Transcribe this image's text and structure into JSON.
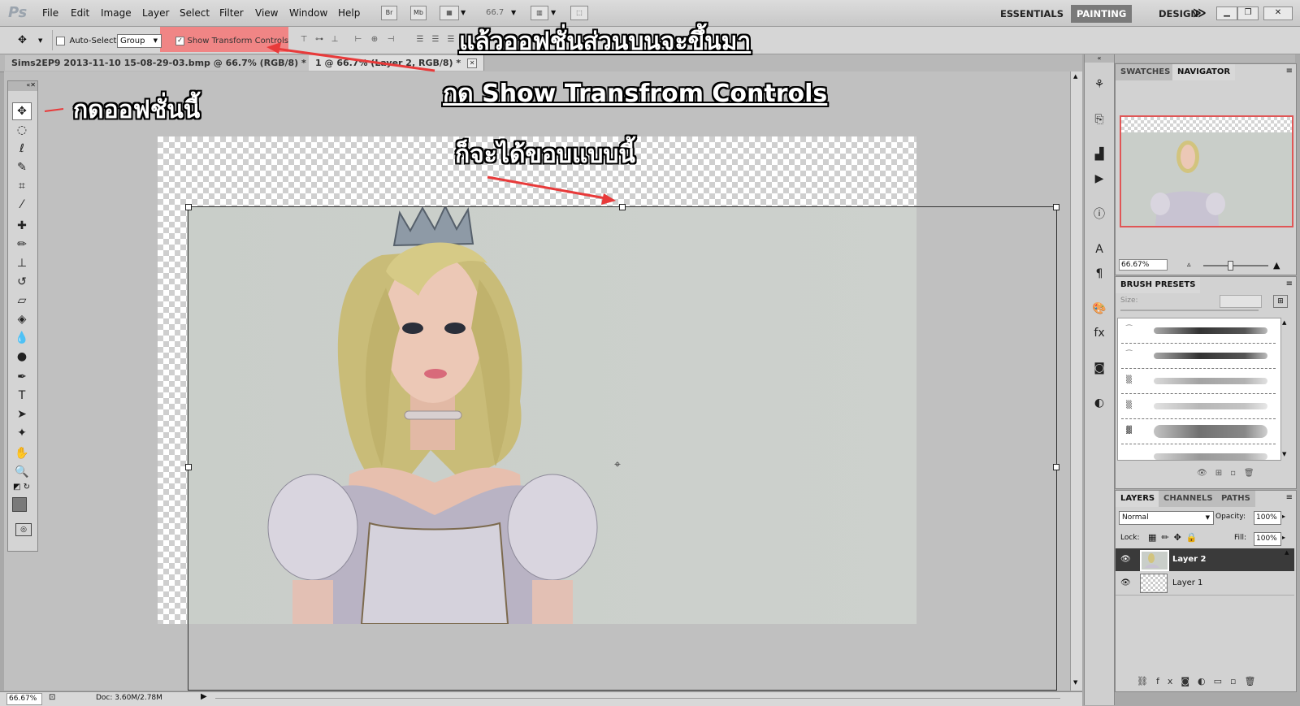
{
  "app": {
    "logo": "Ps",
    "menu": [
      "File",
      "Edit",
      "Image",
      "Layer",
      "Select",
      "Filter",
      "View",
      "Window",
      "Help"
    ],
    "bridge_buttons": [
      "Br",
      "Mb"
    ],
    "zoom_combo": "66.7",
    "workspaces": [
      "ESSENTIALS",
      "PAINTING",
      "DESIGN"
    ],
    "active_workspace": "PAINTING",
    "more_glyph": "≫"
  },
  "options_bar": {
    "auto_select_label": "Auto-Select:",
    "auto_select_checked": false,
    "auto_select_value": "Group",
    "show_transform_label": "Show Transform Controls",
    "show_transform_checked": true
  },
  "tabs": [
    {
      "label": "Sims2EP9 2013-11-10 15-08-29-03.bmp @ 66.7% (RGB/8) *",
      "active": false
    },
    {
      "label": "1 @ 66.7% (Layer 2, RGB/8) *",
      "active": true
    }
  ],
  "annotations": {
    "top": "แล้วออฟชั่นส่วนบนจะขึ้นมา",
    "show": "กด Show Transfrom Controls",
    "tool": "กดออฟชั่นนี้",
    "border": "ก็จะได้ขอบแบบนี้"
  },
  "navigator": {
    "tabs": [
      "SWATCHES",
      "NAVIGATOR"
    ],
    "active_tab": "NAVIGATOR",
    "zoom": "66.67%"
  },
  "brush_presets": {
    "title": "BRUSH PRESETS",
    "size_label": "Size:"
  },
  "layers_panel": {
    "tabs": [
      "LAYERS",
      "CHANNELS",
      "PATHS"
    ],
    "active_tab": "LAYERS",
    "blend_mode": "Normal",
    "opacity_label": "Opacity:",
    "opacity": "100%",
    "lock_label": "Lock:",
    "fill_label": "Fill:",
    "fill": "100%",
    "layers": [
      {
        "name": "Layer 2",
        "selected": true
      },
      {
        "name": "Layer 1",
        "selected": false
      }
    ]
  },
  "status": {
    "zoom": "66.67%",
    "doc": "Doc: 3.60M/2.78M"
  },
  "colors": {
    "highlight": "#f08585",
    "arrow": "#e83a3a",
    "canvas_bg": "#c9cec9",
    "selected_layer": "#3a3a3a"
  }
}
